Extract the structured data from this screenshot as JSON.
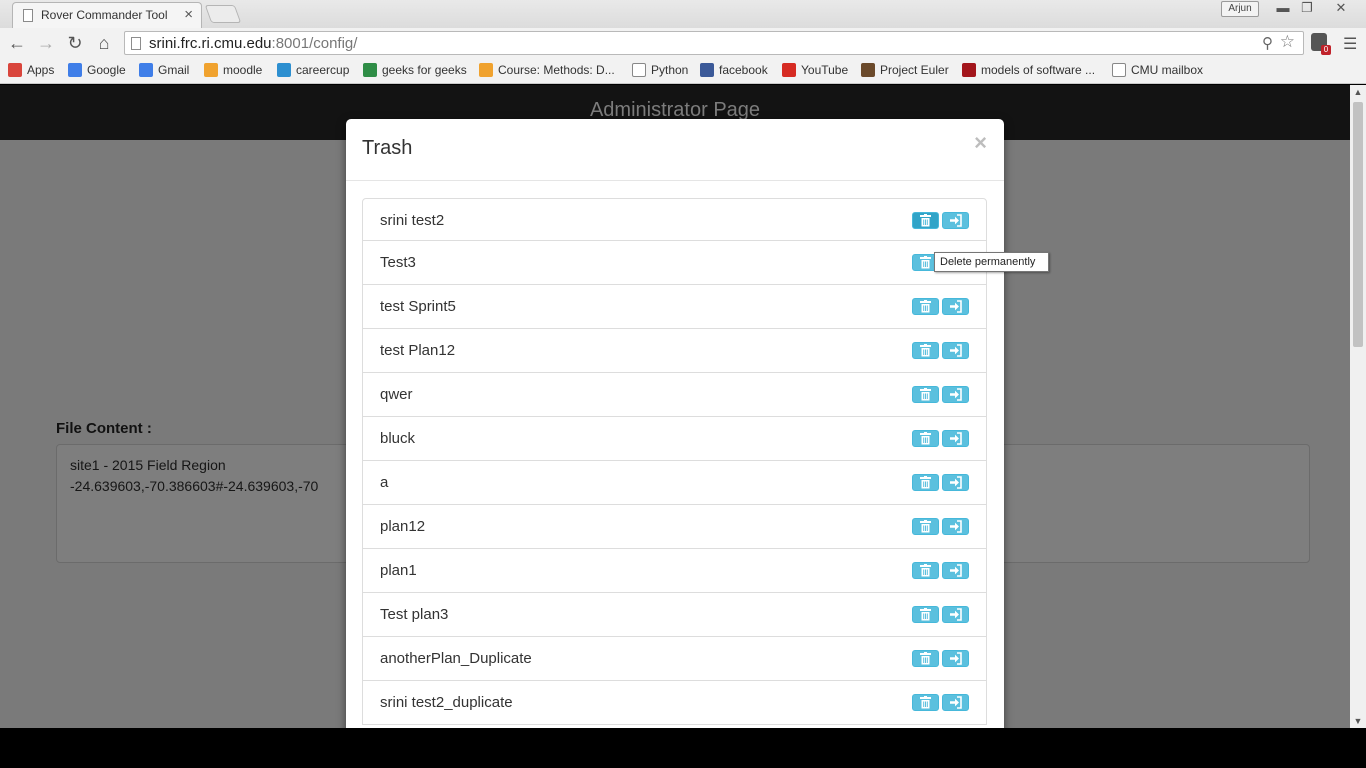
{
  "browser": {
    "tab_title": "Rover Commander Tool",
    "tab_close": "×",
    "user_name": "Arjun",
    "url_host": "srini.frc.ri.cmu.edu",
    "url_path": ":8001/config/",
    "extension_badge": "0",
    "bookmarks": [
      {
        "label": "Apps",
        "icon": "apps-grid-icon",
        "color": "#d9453c"
      },
      {
        "label": "Google",
        "icon": "google-icon",
        "color": "#3f7ee8"
      },
      {
        "label": "Gmail",
        "icon": "gmail-icon",
        "color": "#3f7ee8"
      },
      {
        "label": "moodle",
        "icon": "moodle-icon",
        "color": "#f0a22e"
      },
      {
        "label": "careercup",
        "icon": "careercup-icon",
        "color": "#2d8fd0"
      },
      {
        "label": "geeks for geeks",
        "icon": "geeksforgeeks-icon",
        "color": "#2f8d46"
      },
      {
        "label": "Course: Methods: D...",
        "icon": "moodle-icon",
        "color": "#f0a22e"
      },
      {
        "label": "Python",
        "icon": "page-icon",
        "color": "#ffffff"
      },
      {
        "label": "facebook",
        "icon": "facebook-icon",
        "color": "#3b5998"
      },
      {
        "label": "YouTube",
        "icon": "youtube-icon",
        "color": "#d62b23"
      },
      {
        "label": "Project Euler",
        "icon": "project-euler-icon",
        "color": "#6b4a2b"
      },
      {
        "label": "models of software ...",
        "icon": "cmu-icon",
        "color": "#a3161c"
      },
      {
        "label": "CMU mailbox",
        "icon": "mail-icon",
        "color": "#ffffff"
      }
    ]
  },
  "page": {
    "header_title": "Administrator Page",
    "file_content_label": "File Content :",
    "file_content_text": "site1 - 2015 Field Region\n-24.639603,-70.386603#-24.639603,-70"
  },
  "modal": {
    "title": "Trash",
    "close": "×",
    "items": [
      "srini test2",
      "Test3",
      "test Sprint5",
      "test Plan12",
      "qwer",
      "bluck",
      "a",
      "plan12",
      "plan1",
      "Test plan3",
      "anotherPlan_Duplicate",
      "srini test2_duplicate"
    ],
    "tooltip": "Delete permanently"
  },
  "colors": {
    "info_button": "#5bc0de",
    "overlay": "#7a7a7a",
    "admin_bar": "#131313"
  }
}
